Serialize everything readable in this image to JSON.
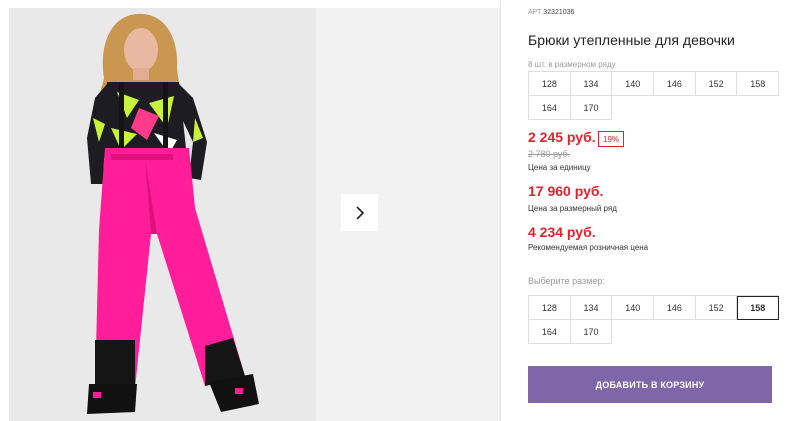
{
  "product": {
    "article_label": "АРТ",
    "article": "32321036",
    "title": "Брюки утепленные для девочки",
    "pack_note": "8 шт. в размерном ряду"
  },
  "pack_sizes": [
    "128",
    "134",
    "140",
    "146",
    "152",
    "158",
    "164",
    "170"
  ],
  "prices": {
    "unit_price": "2 245 руб.",
    "discount": "19%",
    "old_price": "2 780 руб.",
    "unit_label": "Цена за единицу",
    "set_price": "17 960 руб.",
    "set_label": "Цена за размерный ряд",
    "retail_price": "4 234 руб.",
    "retail_label": "Рекомендуемая розничная цена"
  },
  "size_select": {
    "label": "Выберите размер:",
    "options": [
      "128",
      "134",
      "140",
      "146",
      "152",
      "158",
      "164",
      "170"
    ],
    "selected": "158"
  },
  "cart": {
    "label": "ДОБАВИТЬ В КОРЗИНУ"
  },
  "gallery": {
    "next_icon": "chevron-right-icon"
  },
  "colors": {
    "accent": "#7e66a8",
    "price": "#e0222c",
    "pants": "#ff1493"
  }
}
